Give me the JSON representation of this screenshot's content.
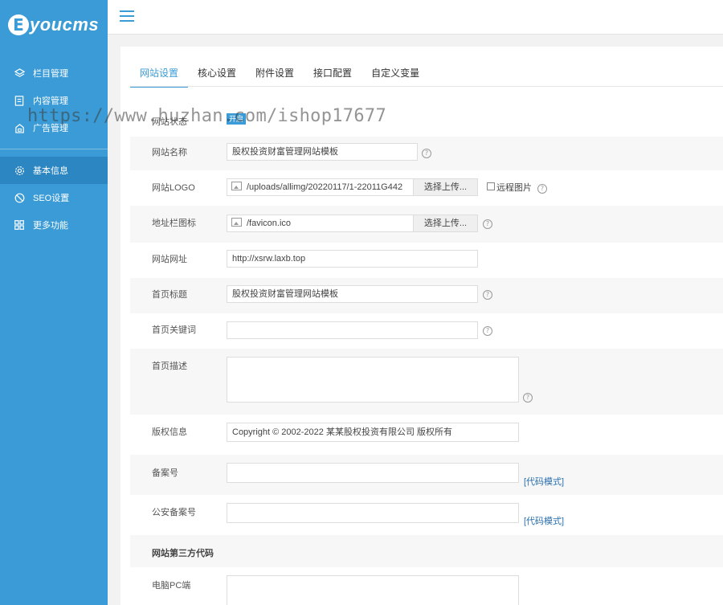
{
  "logo": {
    "badge": "E",
    "text": "youcms"
  },
  "sidebar": {
    "items": [
      {
        "label": "栏目管理",
        "icon": "layers-icon"
      },
      {
        "label": "内容管理",
        "icon": "document-icon"
      },
      {
        "label": "广告管理",
        "icon": "ad-icon"
      },
      {
        "label": "基本信息",
        "icon": "gear-icon",
        "active": true
      },
      {
        "label": "SEO设置",
        "icon": "seo-icon"
      },
      {
        "label": "更多功能",
        "icon": "grid-icon"
      }
    ]
  },
  "tabs": [
    {
      "label": "网站设置",
      "active": true
    },
    {
      "label": "核心设置"
    },
    {
      "label": "附件设置"
    },
    {
      "label": "接口配置"
    },
    {
      "label": "自定义变量"
    }
  ],
  "watermark": "https://www.huzhan.com/ishop17677",
  "form": {
    "status_label": "网站状态",
    "status_value": "开启",
    "site_name_label": "网站名称",
    "site_name_value": "股权投资财富管理网站模板",
    "logo_label": "网站LOGO",
    "logo_value": "/uploads/allimg/20220117/1-22011G442",
    "upload_label": "选择上传...",
    "remote_image_label": "远程图片",
    "favicon_label": "地址栏图标",
    "favicon_value": "/favicon.ico",
    "site_url_label": "网站网址",
    "site_url_value": "http://xsrw.laxb.top",
    "home_title_label": "首页标题",
    "home_title_value": "股权投资财富管理网站模板",
    "home_keywords_label": "首页关键词",
    "home_keywords_value": "",
    "home_desc_label": "首页描述",
    "home_desc_value": "",
    "copyright_label": "版权信息",
    "copyright_value": "Copyright © 2002-2022 某某股权投资有限公司 版权所有",
    "icp_label": "备案号",
    "icp_value": "",
    "code_mode_label": "[代码模式]",
    "police_label": "公安备案号",
    "police_value": "",
    "third_party_title": "网站第三方代码",
    "pc_label": "电脑PC端",
    "pc_value": ""
  },
  "help_glyph": "?",
  "colors": {
    "primary": "#3a9bd6",
    "sidebar_active": "#2b86c1",
    "link": "#2a6fb0"
  }
}
